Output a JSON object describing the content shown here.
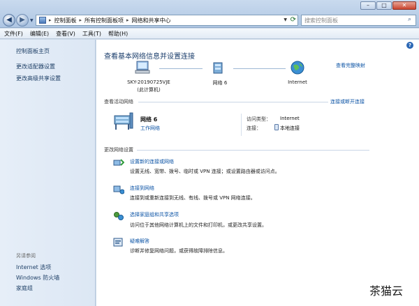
{
  "address": {
    "crumbs": [
      "控制面板",
      "所有控制面板项",
      "网络和共享中心"
    ],
    "search_placeholder": "搜索控制面板"
  },
  "window_controls": {
    "minimize": "–",
    "maximize": "□",
    "close": "✕"
  },
  "menu": [
    "文件(F)",
    "编辑(E)",
    "查看(V)",
    "工具(T)",
    "帮助(H)"
  ],
  "sidebar": {
    "items": [
      "控制面板主页",
      "更改适配器设置",
      "更改高级共享设置"
    ],
    "see_also_heading": "另请参阅",
    "see_also": [
      "Internet 选项",
      "Windows 防火墙",
      "家庭组"
    ]
  },
  "main": {
    "heading": "查看基本网络信息并设置连接",
    "full_map_link": "查看完整映射",
    "map_nodes": [
      {
        "name": "SKY-20190725VJE",
        "sub": "(此计算机)"
      },
      {
        "name": "网络  6",
        "sub": ""
      },
      {
        "name": "Internet",
        "sub": ""
      }
    ],
    "active_section": "查看活动网络",
    "connect_disconnect_link": "连接或断开连接",
    "active_network": {
      "name": "网络  6",
      "type": "工作网络",
      "access_label": "访问类型：",
      "access_value": "Internet",
      "connection_label": "连接：",
      "connection_value": "本地连接"
    },
    "change_section": "更改网络设置",
    "tasks": [
      {
        "title": "设置新的连接或网络",
        "desc": "设置无线、宽带、拨号、临时或 VPN 连接；或设置路由器或访问点。"
      },
      {
        "title": "连接到网络",
        "desc": "连接到或重新连接到无线、有线、拨号或 VPN 网络连接。"
      },
      {
        "title": "选择家庭组和共享选项",
        "desc": "访问位于其他网络计算机上的文件和打印机，或更改共享设置。"
      },
      {
        "title": "疑难解答",
        "desc": "诊断并修复网络问题，或获得故障排除信息。"
      }
    ]
  },
  "watermark": "茶猫云",
  "colors": {
    "link": "#0b53a5",
    "heading": "#1a3d6b",
    "sidebar_bg": "#e6eef8",
    "title_bar": "#b9cfe9"
  },
  "icons": [
    "back-arrow-icon",
    "forward-arrow-icon",
    "control-panel-icon",
    "refresh-icon",
    "search-icon",
    "help-icon",
    "computer-icon",
    "network-icon",
    "globe-icon",
    "bench-icon",
    "network-adapter-icon",
    "new-connection-icon",
    "connect-network-icon",
    "homegroup-icon",
    "troubleshoot-icon"
  ]
}
